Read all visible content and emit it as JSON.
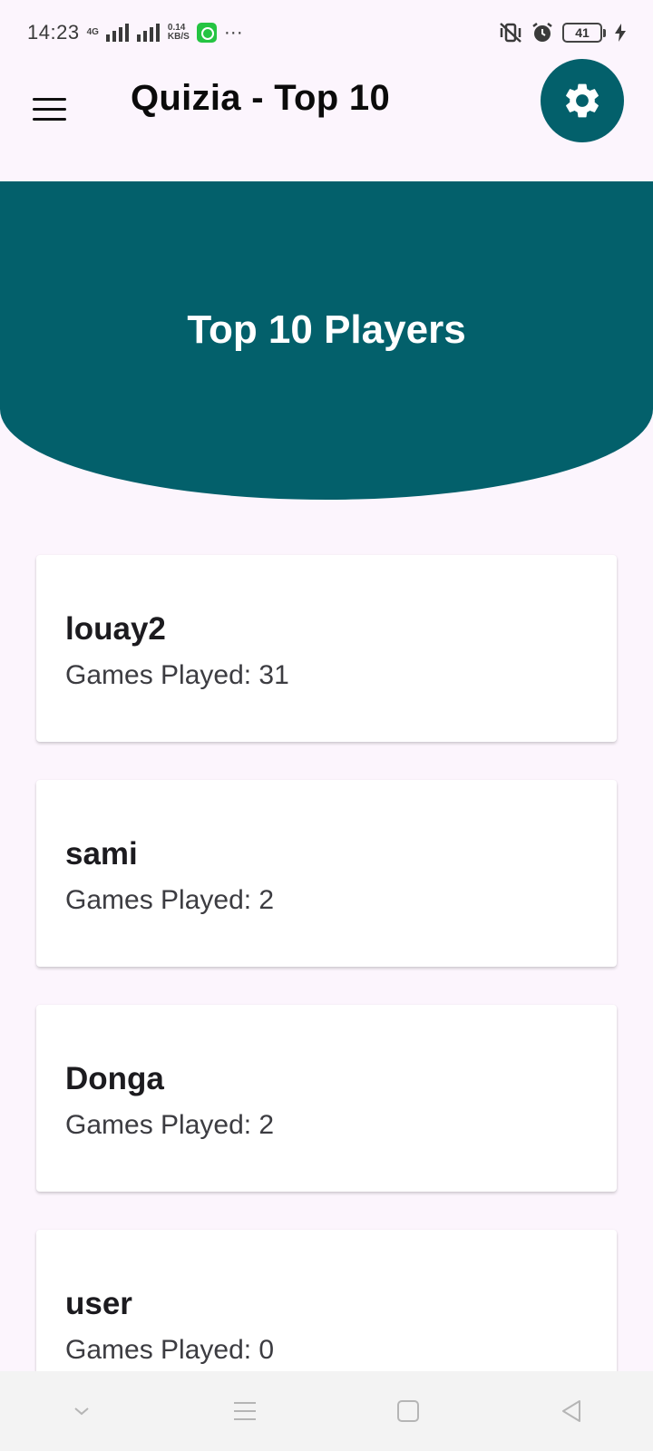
{
  "status_bar": {
    "time": "14:23",
    "network_type": "4G",
    "data_rate_value": "0.14",
    "data_rate_unit": "KB/S",
    "more": "···",
    "battery_level": "41"
  },
  "app_bar": {
    "title": "Quizia - Top 10",
    "menu_icon": "hamburger-menu-icon",
    "settings_icon": "gear-icon"
  },
  "hero": {
    "title": "Top 10 Players"
  },
  "players": [
    {
      "name": "louay2",
      "games_played": "Games Played: 31"
    },
    {
      "name": "sami",
      "games_played": "Games Played: 2"
    },
    {
      "name": "Donga",
      "games_played": "Games Played: 2"
    },
    {
      "name": "user",
      "games_played": "Games Played: 0"
    }
  ],
  "colors": {
    "primary": "#03606b",
    "background": "#fcf5fd",
    "card": "#ffffff"
  },
  "nav_bar": {
    "icons": [
      "chevron-down-icon",
      "recents-icon",
      "home-icon",
      "back-icon"
    ]
  }
}
